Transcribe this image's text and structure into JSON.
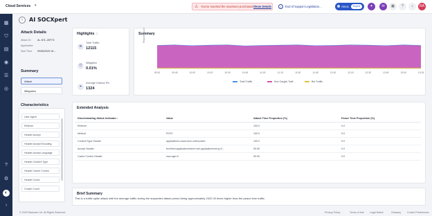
{
  "topbar": {
    "brand": "Cloud Services",
    "alert_text": "You've reached the maximum purchased",
    "alert_link": "Show Details",
    "support_text": "End of Support Legislation...",
    "pill_label": "AIsoc",
    "pill_badge": "Expert",
    "user_initials": "RA"
  },
  "header": {
    "back_glyph": "‹",
    "title": "AI SOCXpert"
  },
  "attack_details": {
    "title": "Attack Details",
    "fields": [
      {
        "label": "Attack ID",
        "value": "AL-NTL-26F7G"
      },
      {
        "label": "Application",
        "value": ""
      },
      {
        "label": "Start Time",
        "value": "09/06/2025 16:..."
      }
    ]
  },
  "summary": {
    "title": "Summary",
    "items": [
      "Attack",
      "Mitigation"
    ]
  },
  "characteristics": {
    "title": "Characteristics",
    "items": [
      "User Agent",
      "Referrer",
      "Header Accept",
      "Header Accept Encoding",
      "Header Accept Language",
      "Header Content Type",
      "Header Cache Control",
      "Header Count",
      "Cookie Count"
    ]
  },
  "highlights": {
    "title": "Highlights",
    "items": [
      {
        "label": "Total Traffic",
        "value": "12115",
        "icon": "traffic-icon"
      },
      {
        "label": "Mitigation",
        "value": "0.01%",
        "icon": "shield-icon"
      },
      {
        "label": "Average Distinct IPs",
        "value": "1324",
        "icon": "ip-icon"
      }
    ]
  },
  "summary_chart": {
    "title": "Summary",
    "ylabel": "Request count",
    "x_ticks": [
      "09:30",
      "09:45",
      "10:00",
      "10:15",
      "10:30",
      "10:45",
      "11:00",
      "11:15",
      "11:30",
      "11:45",
      "12:00",
      "12:15",
      "12:30",
      "12:45",
      "13:00",
      "13:15"
    ],
    "legend": [
      {
        "name": "Total Traffic",
        "color": "#4a8fe8"
      },
      {
        "name": "Non Caught Traff...",
        "color": "#d44fb0"
      },
      {
        "name": "Bot Traffic",
        "color": "#e2c23a"
      }
    ]
  },
  "chart_data": {
    "type": "area",
    "x": [
      "09:30",
      "09:45",
      "10:00",
      "10:15",
      "10:30",
      "10:45",
      "11:00",
      "11:15",
      "11:30",
      "11:45",
      "12:00",
      "12:15",
      "12:30",
      "12:45",
      "13:00",
      "13:15"
    ],
    "series": [
      {
        "name": "Total Traffic",
        "values": [
          0.88,
          0.9,
          0.87,
          0.89,
          0.9,
          0.86,
          0.88,
          0.89,
          0.9,
          0.87,
          0.88,
          0.9,
          0.89,
          0.87,
          0.9,
          0.88
        ]
      },
      {
        "name": "Non Caught Traff...",
        "values": [
          0.86,
          0.88,
          0.85,
          0.87,
          0.88,
          0.84,
          0.86,
          0.87,
          0.88,
          0.85,
          0.86,
          0.88,
          0.87,
          0.85,
          0.88,
          0.86
        ]
      },
      {
        "name": "Bot Traffic",
        "values": [
          0.02,
          0.02,
          0.02,
          0.02,
          0.02,
          0.02,
          0.02,
          0.02,
          0.02,
          0.02,
          0.02,
          0.02,
          0.02,
          0.02,
          0.02,
          0.02
        ]
      }
    ],
    "ylabel": "Request count",
    "grid": false,
    "legend": "bottom"
  },
  "extended": {
    "title": "Extended Analysis",
    "headers": [
      "Discriminating Attack Indicator",
      "Value",
      "Attack Time Proportion (%)",
      "Peace Time Proportion (%)"
    ],
    "rows": [
      [
        "Referrer",
        "",
        "100.0",
        "0.0"
      ],
      [
        "Method",
        "POST",
        "100.0",
        "0.0"
      ],
      [
        "Content Type Header",
        "application/x-www-form-urlencoded",
        "100.0",
        "0.0"
      ],
      [
        "Accept Header",
        "text/html,application/xhtml+xml,application/xml;q=0...",
        "99.99",
        "0.0"
      ],
      [
        "Cache Control Header",
        "max-age=0",
        "99.99",
        "0.0"
      ]
    ]
  },
  "brief": {
    "title": "Brief Summary",
    "text": "This is a traffic spike attack with the average traffic during the suspected attack period being approximately 2422.00 times higher than the peace time traffic."
  },
  "footer": {
    "copyright": "© 2025 Radware Ltd. All Rights Reserved",
    "links": [
      "Privacy Policy",
      "Terms of Use",
      "Legal Notice",
      "Glossary",
      "Cookie Preferences"
    ]
  }
}
